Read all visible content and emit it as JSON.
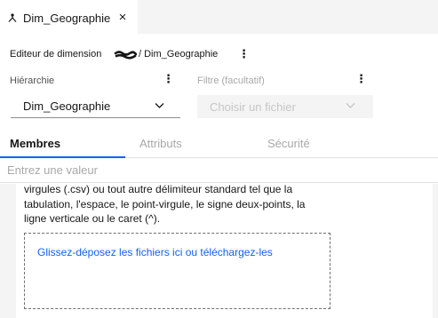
{
  "document_tab": {
    "title": "Dim_Geographie",
    "close_glyph": "×",
    "icon": "hierarchy-icon"
  },
  "editor": {
    "heading": "Editeur de dimension",
    "path": "/ Dim_Geographie",
    "menu_glyph": "⋮"
  },
  "hierarchy": {
    "label": "Hiérarchie",
    "selected": "Dim_Geographie",
    "menu_glyph": "⋮"
  },
  "filter": {
    "label": "Filtre (facultatif)",
    "placeholder": "Choisir un fichier",
    "menu_glyph": "⋮"
  },
  "tabs": [
    {
      "label": "Membres",
      "active": true
    },
    {
      "label": "Attributs",
      "active": false
    },
    {
      "label": "Sécurité",
      "active": false
    }
  ],
  "search": {
    "placeholder": "Entrez une valeur"
  },
  "content": {
    "description": "virgules (.csv) ou tout autre délimiteur standard tel que la tabulation, l'espace, le point-virgule, le signe deux-points, la ligne verticale ou le caret (^).",
    "dropzone_text": "Glissez-déposez les fichiers ici ou téléchargez-les"
  },
  "colors": {
    "accent": "#0f62fe",
    "text": "#161616",
    "muted": "#a8a8a8",
    "panel": "#f4f4f4"
  }
}
